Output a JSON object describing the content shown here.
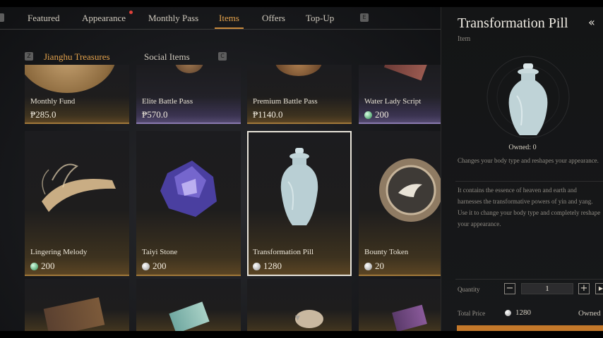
{
  "top_nav": {
    "tabs": [
      {
        "label": "Featured"
      },
      {
        "label": "Appearance",
        "badge": true
      },
      {
        "label": "Monthly Pass"
      },
      {
        "label": "Items",
        "active": true
      },
      {
        "label": "Offers"
      },
      {
        "label": "Top-Up"
      }
    ],
    "key_right": "E"
  },
  "sub_nav": {
    "tabs": [
      {
        "label": "Jianghu Treasures",
        "active": true
      },
      {
        "label": "Social Items"
      }
    ],
    "key_left": "Z",
    "key_right": "C"
  },
  "items": [
    {
      "name": "Monthly Fund",
      "price": "₱285.0",
      "currency": "peso"
    },
    {
      "name": "Elite Battle Pass",
      "price": "₱570.0",
      "currency": "peso"
    },
    {
      "name": "Premium Battle Pass",
      "price": "₱1140.0",
      "currency": "peso"
    },
    {
      "name": "Water Lady Script",
      "price": "200",
      "currency": "jade-coin"
    },
    {
      "name": "Lingering Melody",
      "price": "200",
      "currency": "jade-coin"
    },
    {
      "name": "Taiyi Stone",
      "price": "200",
      "currency": "silver-coin"
    },
    {
      "name": "Transformation Pill",
      "price": "1280",
      "currency": "silver-coin",
      "selected": true
    },
    {
      "name": "Bounty Token",
      "price": "20",
      "currency": "silver-coin"
    }
  ],
  "detail": {
    "title": "Transformation Pill",
    "category": "Item",
    "owned": "Owned: 0",
    "short_desc": "Changes your body type and reshapes your appearance.",
    "long_desc": "It contains the essence of heaven and earth and harnesses the transformative powers of yin and yang. Use it to change your body type and completely reshape your appearance.",
    "quantity_label": "Quantity",
    "quantity": "1",
    "minus": "−",
    "plus": "+",
    "total_label": "Total Price",
    "total": "1280",
    "owned_short": "Owned"
  },
  "colors": {
    "accent": "#e3a24c",
    "gold_border": "#a2793a",
    "purple_border": "#8a7ab0",
    "buy_button": "#c4782a"
  }
}
